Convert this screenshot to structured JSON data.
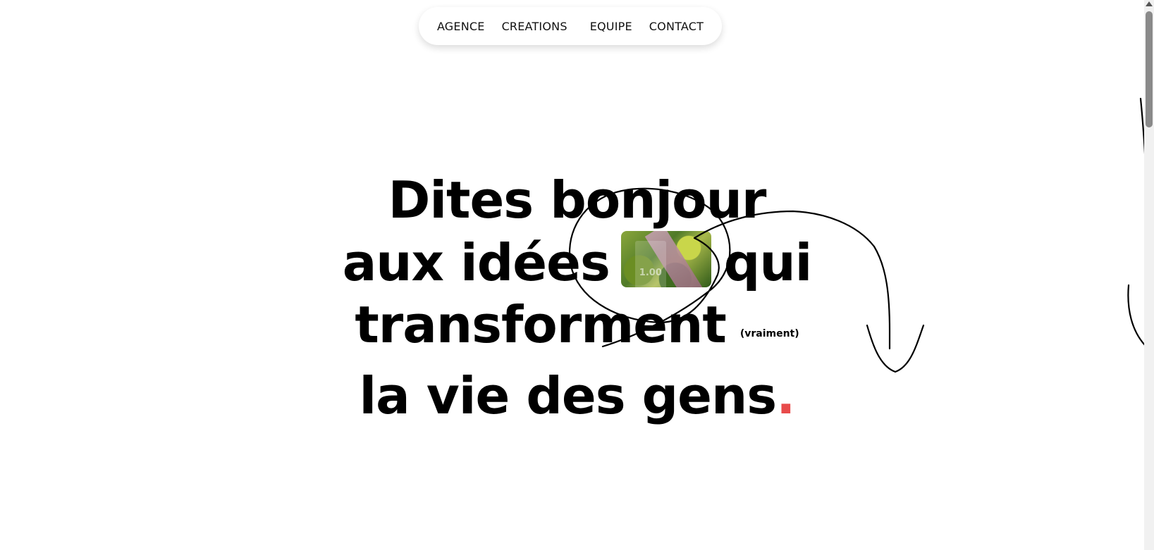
{
  "nav": {
    "items": [
      {
        "label": "AGENCE"
      },
      {
        "label": "CREATIONS"
      },
      {
        "label": "EQUIPE"
      },
      {
        "label": "CONTACT"
      }
    ]
  },
  "hero": {
    "line1": "Dites bonjour",
    "line2_before": "aux idées",
    "line2_after": "qui",
    "line3": "transforment",
    "aside": "(vraiment)",
    "line4": "la vie des gens",
    "line4_punct": "."
  },
  "media": {
    "badge": "1.00"
  },
  "colors": {
    "accent": "#e84a4a",
    "text": "#000000",
    "background": "#ffffff"
  },
  "icons": {
    "scroll_up": "triangle-up-icon"
  }
}
